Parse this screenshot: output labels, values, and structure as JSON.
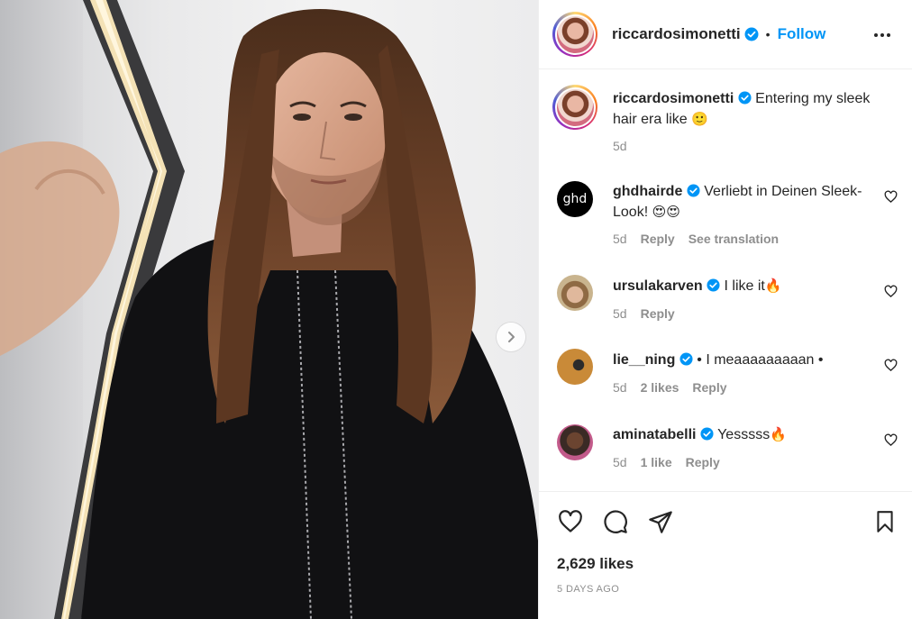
{
  "post": {
    "author": "riccardosimonetti",
    "verified": true,
    "follow_label": "Follow",
    "separator": "•",
    "caption_text": "Entering my sleek hair era like",
    "caption_emoji": "🙂",
    "caption_time": "5d",
    "likes": "2,629 likes",
    "posted_ago": "5 DAYS AGO"
  },
  "comments": [
    {
      "user": "ghdhairde",
      "verified": true,
      "text": "Verliebt in Deinen Sleek-Look!",
      "emoji": "😍😍",
      "time": "5d",
      "likes": "",
      "reply": "Reply",
      "translate": "See translation"
    },
    {
      "user": "ursulakarven",
      "verified": true,
      "text": "I like it",
      "emoji": "🔥",
      "time": "5d",
      "likes": "",
      "reply": "Reply"
    },
    {
      "user": "lie__ning",
      "verified": true,
      "text": "• I meaaaaaaaaan •",
      "emoji": "",
      "time": "5d",
      "likes": "2 likes",
      "reply": "Reply"
    },
    {
      "user": "aminatabelli",
      "verified": true,
      "text": "Yesssss",
      "emoji": "🔥",
      "time": "5d",
      "likes": "1 like",
      "reply": "Reply"
    }
  ],
  "logos": {
    "ghd": "ghd"
  },
  "icons": [
    "heart-icon",
    "comment-icon",
    "share-icon",
    "bookmark-icon",
    "more-icon",
    "chevron-right-icon",
    "verified-icon"
  ],
  "colors": {
    "accent": "#0095f6",
    "verified": "#0095f6",
    "muted": "#8e8e8e",
    "border": "#efefef"
  }
}
